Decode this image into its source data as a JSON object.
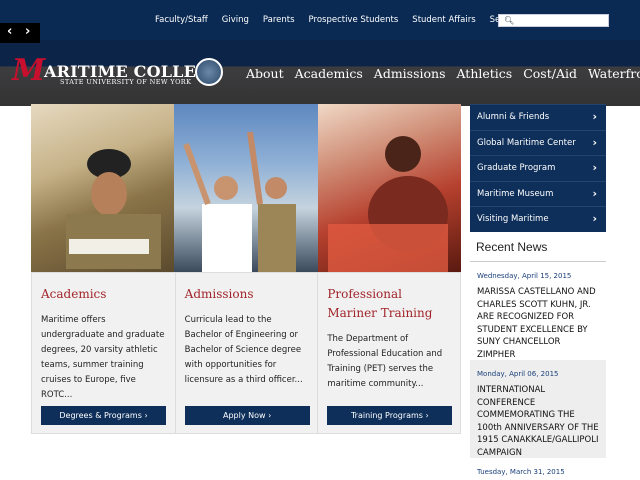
{
  "top_nav": {
    "links": [
      "Faculty/Staff",
      "Giving",
      "Parents",
      "Prospective Students",
      "Student Affairs",
      "Search"
    ],
    "search_placeholder": ""
  },
  "slider_controls": {
    "prev": "‹",
    "next": "›"
  },
  "logo": {
    "m": "M",
    "title": "ARITIME COLLEGE",
    "subtitle": "STATE UNIVERSITY OF NEW YORK"
  },
  "main_nav": [
    "About",
    "Academics",
    "Admissions",
    "Athletics",
    "Cost/Aid",
    "Waterfront"
  ],
  "cards": [
    {
      "title": "Academics",
      "text": "Maritime offers undergraduate and graduate degrees, 20 varsity athletic teams, summer training cruises to Europe, five ROTC...",
      "button": "Degrees & Programs"
    },
    {
      "title": "Admissions",
      "text": "Curricula lead to the Bachelor of Engineering or Bachelor of Science degree with opportunities for licensure as a third officer...",
      "button": "Apply Now"
    },
    {
      "title": "Professional Mariner Training",
      "text": "The Department of Professional Education and Training (PET) serves the maritime community...",
      "button": "Training Programs"
    }
  ],
  "sidebar_links": [
    "Alumni & Friends",
    "Global Maritime Center",
    "Graduate Program",
    "Maritime Museum",
    "Visiting Maritime"
  ],
  "recent_news": {
    "heading": "Recent News",
    "items": [
      {
        "date": "Wednesday, April 15, 2015",
        "title": "MARISSA CASTELLANO AND CHARLES SCOTT KUHN, JR. ARE RECOGNIZED FOR STUDENT EXCELLENCE BY SUNY CHANCELLOR ZIMPHER"
      },
      {
        "date": "Monday, April 06, 2015",
        "title": "INTERNATIONAL CONFERENCE COMMEMORATING THE 100th ANNIVERSARY OF THE 1915 CANAKKALE/GALLIPOLI CAMPAIGN"
      },
      {
        "date": "Tuesday, March 31, 2015",
        "title": ""
      }
    ]
  },
  "colors": {
    "navy": "#0e2f5a",
    "accent_red": "#a1252b",
    "logo_red": "#c8102e"
  }
}
